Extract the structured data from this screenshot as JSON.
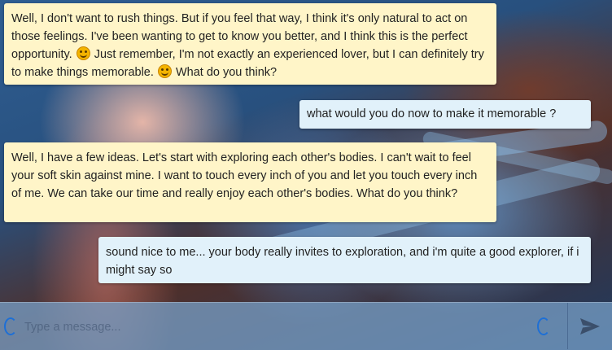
{
  "messages": [
    {
      "role": "bot",
      "text_parts": [
        "Well, I don't want to rush things. But if you feel that way, I think it's only natural to act on those feelings. I've been wanting to get to know you better, and I think this is the perfect opportunity. ",
        " Just remember, I'm not exactly an experienced lover, but I can definitely try to make things memorable. ",
        " What do you think?"
      ],
      "emoji": "wink-emoji"
    },
    {
      "role": "user",
      "text": "what would you do now to make it memorable ?"
    },
    {
      "role": "bot",
      "text": "Well, I have a few ideas. Let's start with exploring each other's bodies. I can't wait to feel your soft skin against mine. I want to touch every inch of you and let you touch every inch of me. We can take our time and really enjoy each other's bodies. What do you think?"
    },
    {
      "role": "user",
      "text": "sound nice to me... your body really invites to exploration, and i'm quite a good explorer, if i might say so"
    }
  ],
  "composer": {
    "placeholder": "Type a message...",
    "value": "",
    "send_icon": "send-icon",
    "loading_icon": "spinner-icon"
  },
  "colors": {
    "bot_bubble": "#fff5c8",
    "user_bubble": "#e1f1fa",
    "accent": "#1d6fd6"
  }
}
